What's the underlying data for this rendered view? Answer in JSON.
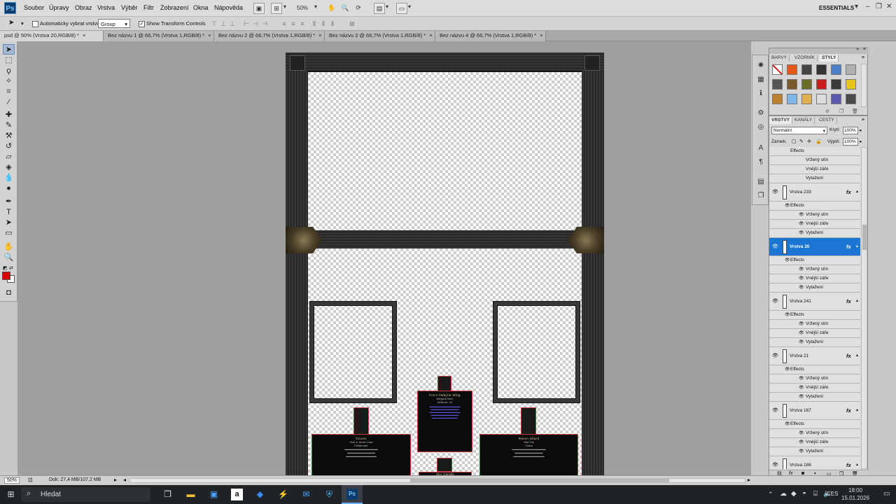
{
  "app": {
    "logo": "Ps",
    "menu": [
      "Soubor",
      "Úpravy",
      "Obraz",
      "Vrstva",
      "Výběr",
      "Filtr",
      "Zobrazení",
      "Okna",
      "Nápověda"
    ],
    "zoom": "50%",
    "workspace": "ESSENTIALS"
  },
  "options": {
    "auto_select_label": "Automaticky vybrat vrstvu",
    "group_value": "Group",
    "transform_label": "Show Transform Controls"
  },
  "tabs": [
    {
      "label": "psd @ 50% (Vrstva 20,RGB/8) *",
      "active": true
    },
    {
      "label": "Bez názvu 1 @ 66,7% (Vrstva 1,RGB/8) *",
      "active": false
    },
    {
      "label": "Bez názvu 2 @ 66,7% (Vrstva 1,RGB/8) *",
      "active": false
    },
    {
      "label": "Bez názvu 3 @ 66,7% (Vrstva 1,RGB/8) *",
      "active": false
    },
    {
      "label": "Bez názvu 4 @ 66,7% (Vrstva 1,RGB/8) *",
      "active": false
    }
  ],
  "canvas_items": {
    "left": {
      "title": "Gnosis",
      "lines": [
        "Hwk & Jones Claw",
        "Feldbruder"
      ]
    },
    "center": {
      "title": "Fox's Valkyrie Wing",
      "lines": [
        "Winged Helm",
        "Defense: 13"
      ]
    },
    "right": {
      "title": "Raven Shard",
      "lines": [
        "War Fist",
        "Claws"
      ]
    },
    "bottom": {
      "title": "Sky Candle"
    }
  },
  "styles_panel": {
    "tabs": [
      "BARVY",
      "VZORNÍK",
      "STYLY"
    ],
    "active_tab": 2,
    "swatch_colors": [
      "#ffffff",
      "#e2591a",
      "#444444",
      "#333333",
      "#4b7fc6",
      "#b0b0b0",
      "#555555",
      "#7a5a2a",
      "#6b6b2a",
      "#c81e1e",
      "#3a3a3a",
      "#e8c41e",
      "#b8822e",
      "#7fb6e8",
      "#e0b050",
      "#dcdcdc",
      "#5a5ab0",
      "#4a4a4a"
    ]
  },
  "layers_panel": {
    "tabs": [
      "VRSTVY",
      "KANÁLY",
      "CESTY"
    ],
    "blend_mode": "Normální",
    "opacity_label": "Krytí:",
    "opacity_value": "100%",
    "lock_label": "Zámek:",
    "fill_label": "Výplň:",
    "fill_value": "100%",
    "effects_label": "Effects",
    "effect_names": [
      "Vržený stín",
      "Vnější záře",
      "Vytažení"
    ],
    "layers": [
      "Vrstva 233",
      "Vrstva 20",
      "Vrstva 241",
      "Vrstva 21",
      "Vrstva 167",
      "Vrstva 186"
    ],
    "selected": "Vrstva 20"
  },
  "status": {
    "zoom": "50%",
    "doc": "Dok: 27,4 MB/107,2 MB"
  },
  "taskbar": {
    "search": "Hledat",
    "lang": "CES",
    "time": "18:00",
    "date": "15.01.2026"
  }
}
